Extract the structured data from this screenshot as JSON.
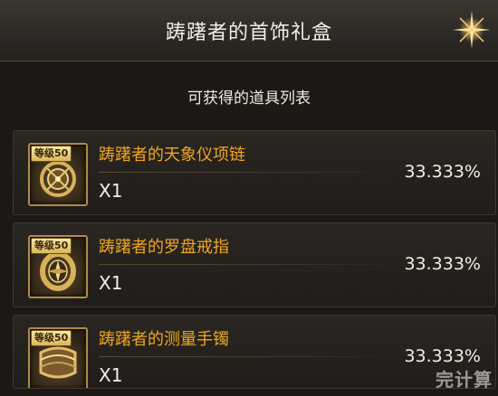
{
  "header": {
    "title": "踌躇者的首饰礼盒",
    "close_icon": "sparkle-close-icon"
  },
  "section": {
    "label": "可获得的道具列表"
  },
  "items": [
    {
      "level_badge": "等级50",
      "name": "踌躇者的天象仪项链",
      "quantity": "X1",
      "chance": "33.333%",
      "icon": "necklace-icon"
    },
    {
      "level_badge": "等级50",
      "name": "踌躇者的罗盘戒指",
      "quantity": "X1",
      "chance": "33.333%",
      "icon": "ring-icon"
    },
    {
      "level_badge": "等级50",
      "name": "踌躇者的测量手镯",
      "quantity": "X1",
      "chance": "33.333%",
      "icon": "bracelet-icon"
    }
  ],
  "watermark": "完计算",
  "colors": {
    "accent": "#f0a624",
    "background": "#1b1815",
    "frame": "#b08a4a"
  }
}
